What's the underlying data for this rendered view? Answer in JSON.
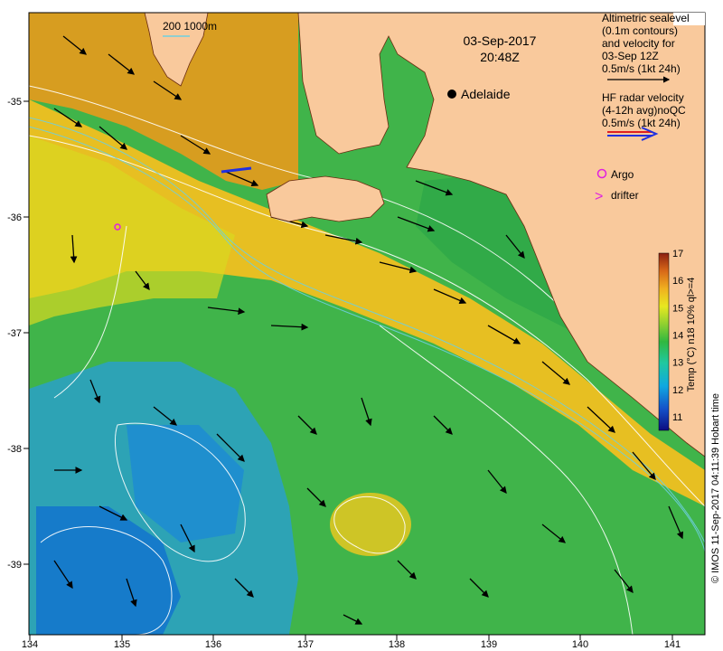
{
  "header": {
    "date": "03-Sep-2017",
    "time": "20:48Z",
    "isobath_label": "200  1000m"
  },
  "legend": {
    "altimetry_lines": [
      "Altimetric sealevel",
      "(0.1m contours)",
      "and velocity for",
      "03-Sep 12Z",
      "0.5m/s (1kt 24h)"
    ],
    "radar_lines": [
      "HF radar velocity",
      "(4-12h avg)noQC",
      "0.5m/s (1kt 24h)"
    ],
    "argo_label": "Argo",
    "drifter_label": "drifter",
    "drifter_symbol": ">"
  },
  "city": {
    "name": "Adelaide"
  },
  "colorbar": {
    "title": "Temp (°C) n18 10% ql>=4",
    "min": 10.5,
    "max": 17,
    "ticks": [
      "11",
      "12",
      "13",
      "14",
      "15",
      "16",
      "17"
    ]
  },
  "axes": {
    "x_ticks": [
      "134",
      "135",
      "136",
      "137",
      "138",
      "139",
      "140",
      "141"
    ],
    "y_ticks": [
      "-35",
      "-36",
      "-37",
      "-38",
      "-39"
    ]
  },
  "credit": "© IMOS 11-Sep-2017 04:11:39 Hobart time",
  "colors": {
    "land": "#f9c99c",
    "contour": "#ffffff",
    "isobath": "#6ecfe0",
    "argo": "#e020e0",
    "radar_blue": "#2030e0",
    "radar_red": "#e02020",
    "city": "#000000"
  }
}
